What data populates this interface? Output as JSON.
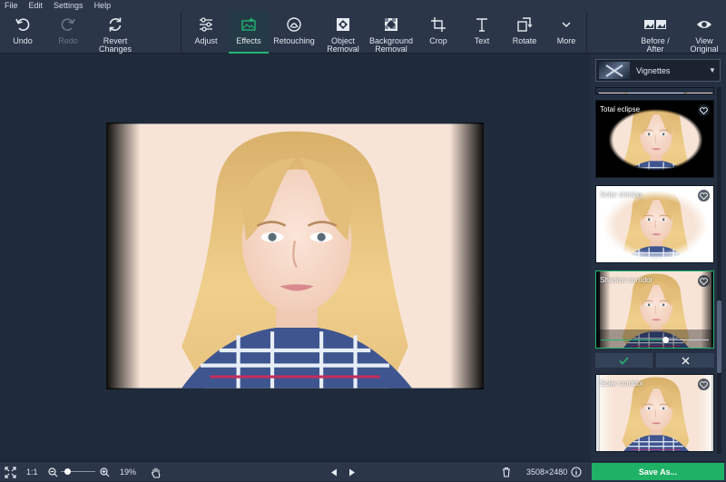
{
  "menu": [
    "File",
    "Edit",
    "Settings",
    "Help"
  ],
  "toolbar": {
    "undo": "Undo",
    "redo": "Redo",
    "revert": "Revert\nChanges",
    "adjust": "Adjust",
    "effects": "Effects",
    "retouching": "Retouching",
    "object_removal": "Object\nRemoval",
    "background_removal": "Background\nRemoval",
    "crop": "Crop",
    "text": "Text",
    "rotate": "Rotate",
    "more": "More",
    "before_after": "Before /\nAfter",
    "view_original": "View\nOriginal"
  },
  "panel": {
    "category": "Vignettes",
    "effects": [
      {
        "name": "Total eclipse"
      },
      {
        "name": "Solar shining"
      },
      {
        "name": "Shadow corridor",
        "selected": true,
        "intensity": 0.6
      },
      {
        "name": "Solar corridor"
      }
    ],
    "apply_icon": "check-icon",
    "cancel_icon": "close-icon"
  },
  "status": {
    "ratio": "1:1",
    "zoom": "19%",
    "zoom_level": 0.2,
    "dimensions": "3508×2480",
    "save": "Save As..."
  },
  "colors": {
    "accent": "#22b573",
    "background": "#1f2a3b",
    "toolbar": "#2b3649",
    "save": "#1fb166"
  }
}
